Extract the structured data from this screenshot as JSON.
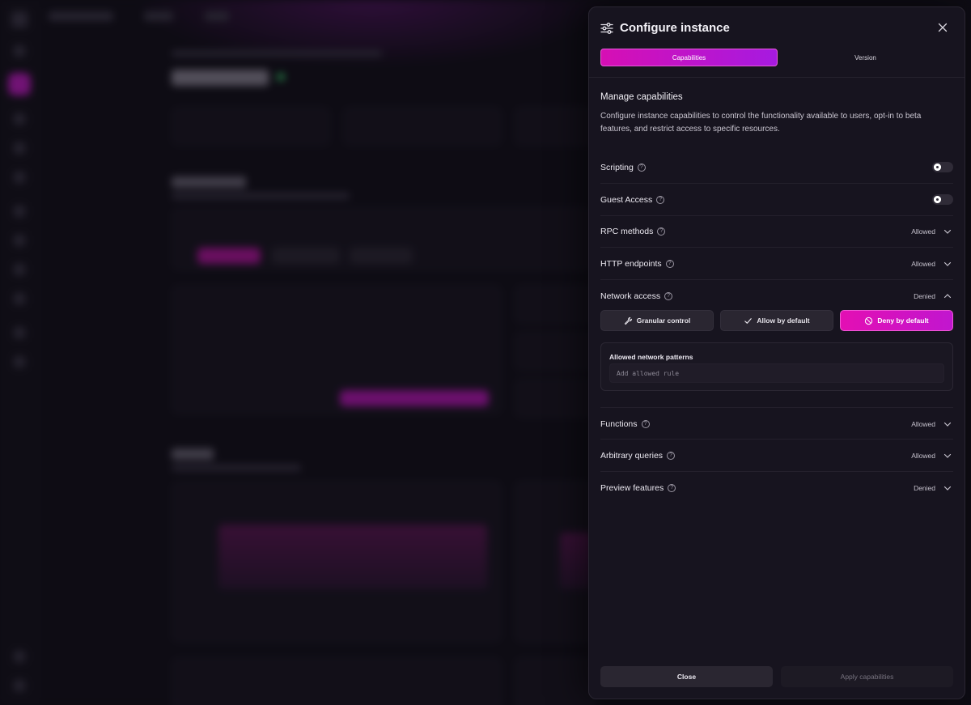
{
  "drawer": {
    "title": "Configure instance",
    "tabs": [
      {
        "label": "Capabilities",
        "active": true
      },
      {
        "label": "Version",
        "active": false
      }
    ],
    "section_title": "Manage capabilities",
    "section_desc": "Configure instance capabilities to control the functionality available to users, opt-in to beta features, and restrict access to specific resources.",
    "capabilities": [
      {
        "label": "Scripting",
        "control": "toggle"
      },
      {
        "label": "Guest Access",
        "control": "toggle"
      },
      {
        "label": "RPC methods",
        "status": "Allowed",
        "expanded": false
      },
      {
        "label": "HTTP endpoints",
        "status": "Allowed",
        "expanded": false
      },
      {
        "label": "Network access",
        "status": "Denied",
        "expanded": true
      },
      {
        "label": "Functions",
        "status": "Allowed",
        "expanded": false
      },
      {
        "label": "Arbitrary queries",
        "status": "Allowed",
        "expanded": false
      },
      {
        "label": "Preview features",
        "status": "Denied",
        "expanded": false
      }
    ],
    "network": {
      "buttons": [
        {
          "label": "Granular control",
          "icon": "wrench-icon",
          "active": false
        },
        {
          "label": "Allow by default",
          "icon": "check-icon",
          "active": false
        },
        {
          "label": "Deny by default",
          "icon": "ban-icon",
          "active": true
        }
      ],
      "patterns_label": "Allowed network patterns",
      "patterns_placeholder": "Add allowed rule"
    },
    "footer": {
      "close_label": "Close",
      "apply_label": "Apply capabilities"
    }
  },
  "colors": {
    "accent": "#d60fb4",
    "accent_2": "#a61ae0",
    "panel_bg": "#17141f"
  }
}
